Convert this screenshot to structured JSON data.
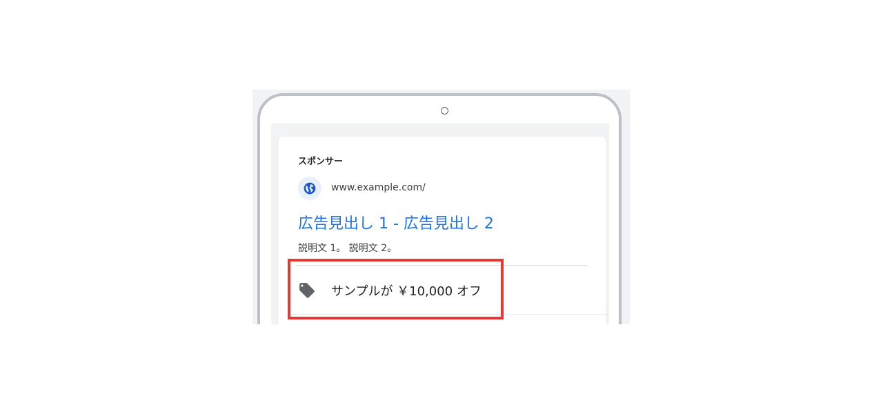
{
  "ad": {
    "sponsor_label": "スポンサー",
    "url": "www.example.com/",
    "headline": "広告見出し 1 - 広告見出し 2",
    "description": "説明文 1。 説明文 2。",
    "promotion": {
      "icon": "tag-icon",
      "text": "サンプルが ￥10,000 オフ"
    },
    "favicon_icon": "globe-icon"
  },
  "colors": {
    "headline_link": "#1a73e8",
    "highlight_border": "#e53935",
    "phone_frame": "#bdc1c6",
    "screen_background": "#f1f3f4",
    "favicon_background": "#e8f0fe"
  }
}
